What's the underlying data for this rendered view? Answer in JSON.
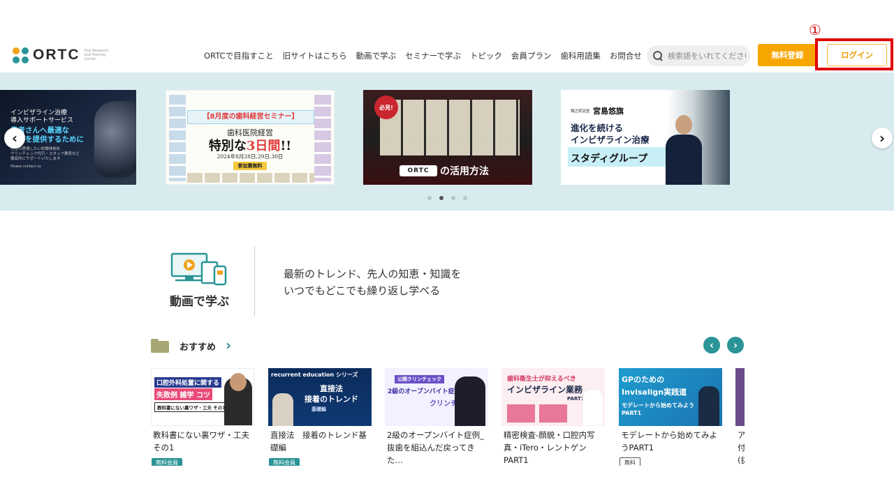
{
  "annotation": {
    "marker": "①"
  },
  "colors": {
    "accent": "#2a9496",
    "orange": "#f7a600",
    "carousel_bg": "#d8ecef",
    "annotation_red": "#e00000"
  },
  "header": {
    "logo_text": "ORTC",
    "logo_tagline": "Oral Research and Training Center",
    "nav": [
      "ORTCで目指すこと",
      "旧サイトはこちら",
      "動画で学ぶ",
      "セミナーで学ぶ",
      "トピック",
      "会員プラン",
      "歯科用語集",
      "お問合せ"
    ],
    "search_placeholder": "検索語をいれてください",
    "register_label": "無料登録",
    "login_label": "ログイン"
  },
  "carousel": {
    "prev_label": "‹",
    "next_label": "›",
    "slides": [
      {
        "line1": "インビザライン治療\n導入サポートサービス",
        "line2": "患者さんへ最適な\n治療を提供するために",
        "line3": "先生の実現したい診療体制を\nクリンチェック代行・スタッフ教育など\n徹底的にサポートいたします",
        "line4": "Please contact us"
      },
      {
        "band": "【8月度の歯科経営セミナー】",
        "line1": "歯科医院経営",
        "line2a": "特別な",
        "line2b": "3日間",
        "line2c": "!!",
        "line3": "2024年8月28日,29日,30日",
        "line4": "参加費無料"
      },
      {
        "badge": "必見!",
        "logo": "ORTC",
        "caption": "の活用方法"
      },
      {
        "line1": "矯正認定医",
        "line2": "宮島悠旗",
        "line3": "進化を続ける\nインビザライン治療",
        "line4": "スタディグループ"
      }
    ],
    "dots": 4,
    "active_dot": 1
  },
  "learn": {
    "title": "動画で学ぶ",
    "desc_line1": "最新のトレンド、先人の知恵・知識を",
    "desc_line2": "いつでもどこでも繰り返し学べる"
  },
  "recommend": {
    "title": "おすすめ",
    "chevron": "›",
    "prev": "‹",
    "next": "›",
    "cards": [
      {
        "title": "教科書にない裏ワザ・工夫その1",
        "tag": "無料会員",
        "tag_type": "member",
        "thumb1": "口腔外科処置に関する",
        "thumb2": "失敗例 雑学 コツ",
        "thumb3": "教科書にない裏ワザ・工夫 その1"
      },
      {
        "title": "直接法　接着のトレンド基礎編",
        "tag": "無料会員",
        "tag_type": "member",
        "thumb1": "recurrent education シリーズ",
        "thumb2": "直接法\n接着のトレンド",
        "thumb3": "基礎編"
      },
      {
        "title": "2級のオープンバイト症例_抜歯を組込んだ戻ってきた…",
        "tag": "",
        "tag_type": "none",
        "thumb1": "公開クリンチェック",
        "thumb2": "2級のオープンバイト症例",
        "thumb3": "クリンチェック"
      },
      {
        "title": "精密検査-顔貌・口腔内写真・iTero・レントゲンPART1",
        "tag": "",
        "tag_type": "none",
        "thumb1": "歯科衛生士が抑えるべき",
        "thumb2": "インビザライン業務",
        "thumb3": "PART1"
      },
      {
        "title": "モデレートから始めてみようPART1",
        "tag": "無料",
        "tag_type": "free",
        "thumb1": "GPのための",
        "thumb2": "Invisalign実践道",
        "thumb3": "モデレートから始めてみよう PART1"
      },
      {
        "title": "ア付(抜",
        "tag": "",
        "tag_type": "none",
        "thumb1": "",
        "thumb2": "",
        "thumb3": ""
      }
    ]
  }
}
